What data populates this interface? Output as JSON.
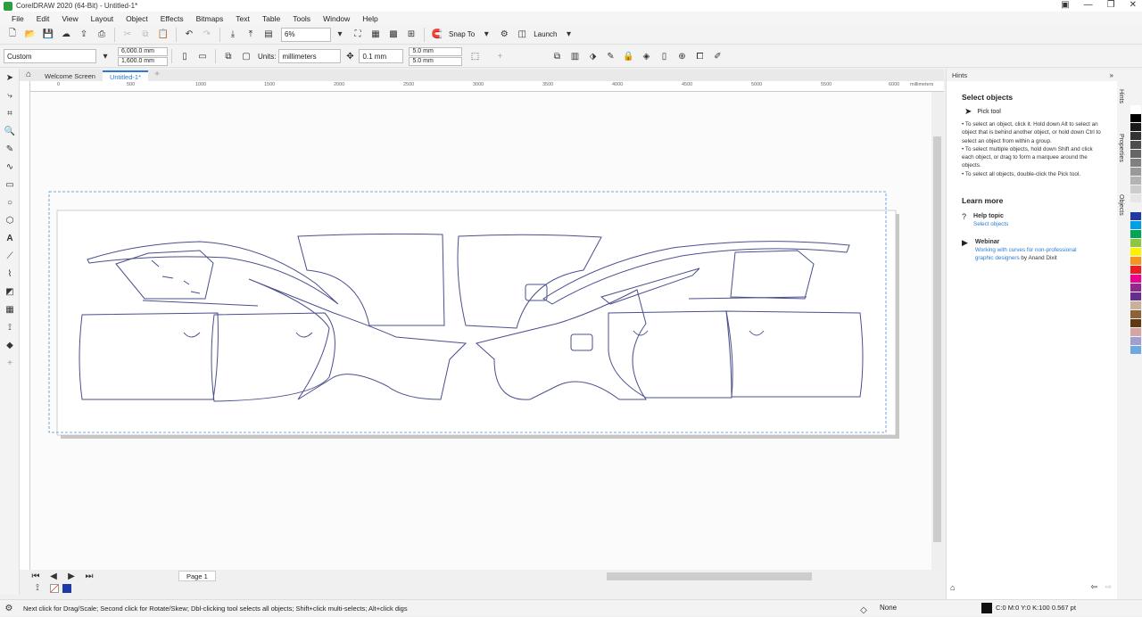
{
  "window": {
    "title": "CorelDRAW 2020 (64-Bit) - Untitled-1*"
  },
  "menu": [
    "File",
    "Edit",
    "View",
    "Layout",
    "Object",
    "Effects",
    "Bitmaps",
    "Text",
    "Table",
    "Tools",
    "Window",
    "Help"
  ],
  "toolbar1": {
    "zoom": "6%",
    "snap_label": "Snap To",
    "launch_label": "Launch"
  },
  "toolbar2": {
    "page_size": "Custom",
    "width": "6,000.0 mm",
    "height": "1,600.0 mm",
    "units_label": "Units:",
    "units_value": "millimeters",
    "nudge": "0.1 mm",
    "dup_x": "5.0 mm",
    "dup_y": "5.0 mm"
  },
  "tabs": {
    "welcome": "Welcome Screen",
    "document": "Untitled-1*"
  },
  "ruler": {
    "unit": "millimeters",
    "ticks": [
      "0",
      "500",
      "1000",
      "1500",
      "2000",
      "2500",
      "3000",
      "3500",
      "4000",
      "4500",
      "5000",
      "5500",
      "6000"
    ]
  },
  "page_tab": "Page 1",
  "docker": {
    "header": "Hints",
    "heading": "Select objects",
    "tool_name": "Pick tool",
    "bullets": [
      "To select an object, click it. Hold down Alt to select an object that is behind another object, or hold down Ctrl to select an object from within a group.",
      "To select multiple objects, hold down Shift and click each object, or drag to form a marquee around the objects.",
      "To select all objects, double-click the Pick tool."
    ],
    "learn_more": "Learn more",
    "help_topic_label": "Help topic",
    "help_topic_link": "Select objects",
    "webinar_label": "Webinar",
    "webinar_link": "Working with curves for non-professional graphic designers",
    "webinar_by": "by Anand Dixit",
    "side_tabs": [
      "Hints",
      "Properties",
      "Objects"
    ]
  },
  "status": {
    "hint": "Next click for Drag/Scale; Second click for Rotate/Skew; Dbl-clicking tool selects all objects; Shift+click multi-selects; Alt+click digs",
    "fill": "None",
    "outline": "C:0 M:0 Y:0 K:100  0.567 pt"
  },
  "colors": {
    "accent": "#2b7bd6",
    "outline": "#4a4f8c",
    "palette": [
      "#ffffff",
      "#000000",
      "#1a1a1a",
      "#333333",
      "#4d4d4d",
      "#666666",
      "#808080",
      "#999999",
      "#b3b3b3",
      "#cccccc",
      "#e6e6e6",
      "#f2f2f2",
      "#1f3aa6",
      "#00a0e6",
      "#00a651",
      "#8dc63f",
      "#fff200",
      "#f7941d",
      "#ed1c24",
      "#ec008c",
      "#92278f",
      "#662d91",
      "#c7b299",
      "#8c6239",
      "#603913",
      "#d4a5a5",
      "#a0a0d0",
      "#6fa8dc"
    ]
  }
}
